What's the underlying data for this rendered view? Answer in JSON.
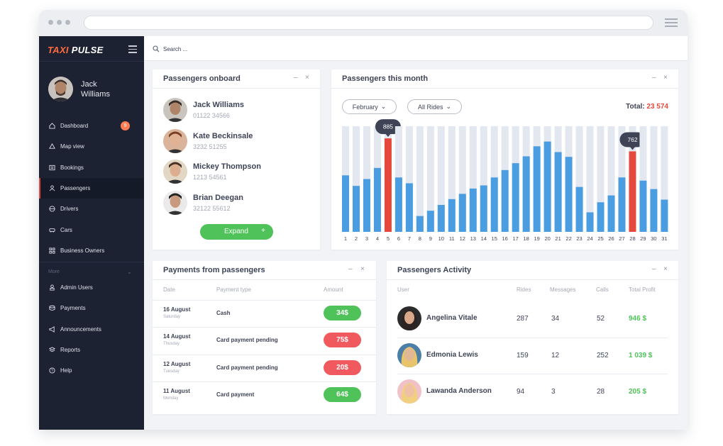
{
  "app": {
    "logo_part1": "TAXI",
    "logo_part2": "PULSE"
  },
  "user": {
    "name_line1": "Jack",
    "name_line2": "Williams"
  },
  "sidebar": {
    "items": [
      {
        "label": "Dashboard",
        "icon": "home-icon",
        "badge": "9"
      },
      {
        "label": "Map view",
        "icon": "map-icon"
      },
      {
        "label": "Bookings",
        "icon": "bookings-icon"
      },
      {
        "label": "Passengers",
        "icon": "passengers-icon",
        "active": true
      },
      {
        "label": "Drivers",
        "icon": "steering-icon"
      },
      {
        "label": "Cars",
        "icon": "car-icon"
      },
      {
        "label": "Business Owners",
        "icon": "grid-icon"
      }
    ],
    "more_label": "More",
    "more_items": [
      {
        "label": "Admin Users",
        "icon": "admin-icon"
      },
      {
        "label": "Payments",
        "icon": "payments-icon"
      },
      {
        "label": "Announcements",
        "icon": "megaphone-icon"
      },
      {
        "label": "Reports",
        "icon": "reports-icon"
      },
      {
        "label": "Help",
        "icon": "help-icon"
      }
    ]
  },
  "search": {
    "placeholder": "Search ..."
  },
  "passengers_onboard": {
    "title": "Passengers onboard",
    "passengers": [
      {
        "name": "Jack Williams",
        "phone": "01122 34566"
      },
      {
        "name": "Kate Beckinsale",
        "phone": "3232 51255"
      },
      {
        "name": "Mickey Thompson",
        "phone": "1213 54561"
      },
      {
        "name": "Brian Deegan",
        "phone": "32122 55612"
      }
    ],
    "expand_label": "Expand",
    "expand_icon": "+"
  },
  "passengers_month": {
    "title": "Passengers this month",
    "month_select": "February",
    "rides_select": "All Rides",
    "total_label": "Total:",
    "total_value": "23 574"
  },
  "chart_data": {
    "type": "bar",
    "categories": [
      "1",
      "2",
      "3",
      "4",
      "5",
      "6",
      "7",
      "8",
      "9",
      "10",
      "11",
      "12",
      "13",
      "14",
      "15",
      "16",
      "17",
      "18",
      "19",
      "20",
      "21",
      "22",
      "23",
      "24",
      "25",
      "26",
      "27",
      "28",
      "29",
      "30",
      "31"
    ],
    "values": [
      535,
      435,
      500,
      605,
      885,
      515,
      460,
      150,
      200,
      255,
      310,
      360,
      410,
      440,
      515,
      585,
      650,
      715,
      810,
      855,
      755,
      710,
      425,
      185,
      280,
      345,
      515,
      762,
      485,
      405,
      305
    ],
    "background_max": 1000,
    "highlighted": [
      {
        "x": "5",
        "label": "885"
      },
      {
        "x": "28",
        "label": "762"
      }
    ],
    "colors": {
      "bar": "#4a9de0",
      "highlight": "#e5493d",
      "track": "#e3e7ef"
    }
  },
  "payments": {
    "title": "Payments from passengers",
    "headers": {
      "date": "Date",
      "type": "Payment type",
      "amount": "Amount"
    },
    "rows": [
      {
        "date": "16 August",
        "day": "Saturday",
        "type": "Cash",
        "amount": "34$",
        "status": "green"
      },
      {
        "date": "14 August",
        "day": "Thusday",
        "type": "Card payment pending",
        "amount": "75$",
        "status": "red"
      },
      {
        "date": "12 August",
        "day": "Tuesday",
        "type": "Card payment pending",
        "amount": "20$",
        "status": "red"
      },
      {
        "date": "11 August",
        "day": "Monday",
        "type": "Card payment",
        "amount": "64$",
        "status": "green"
      }
    ],
    "colors": {
      "green": "#4fc25a",
      "red": "#f05a5f"
    }
  },
  "activity": {
    "title": "Passengers Activity",
    "headers": {
      "user": "User",
      "rides": "Rides",
      "messages": "Messages",
      "calls": "Calls",
      "profit": "Total Profit"
    },
    "rows": [
      {
        "name": "Angelina Vitale",
        "rides": "287",
        "messages": "34",
        "calls": "52",
        "profit": "946 $"
      },
      {
        "name": "Edmonia Lewis",
        "rides": "159",
        "messages": "12",
        "calls": "252",
        "profit": "1 039 $"
      },
      {
        "name": "Lawanda Anderson",
        "rides": "94",
        "messages": "3",
        "calls": "28",
        "profit": "205 $"
      }
    ]
  },
  "card_controls": {
    "minimize": "–",
    "close": "×"
  }
}
